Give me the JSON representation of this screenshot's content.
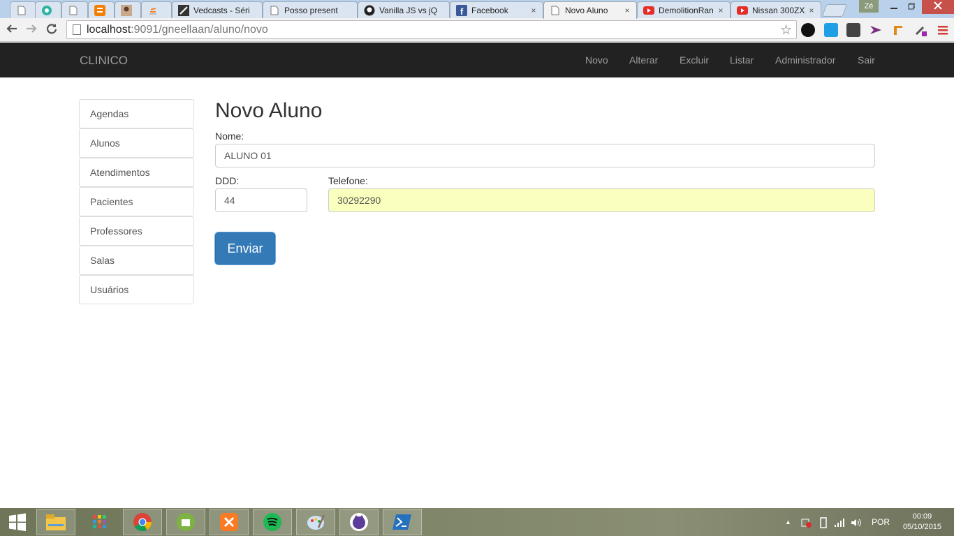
{
  "browser": {
    "tabs": [
      {
        "label": "",
        "icon": "blank-page-icon"
      },
      {
        "label": "",
        "icon": "settings-gear-icon"
      },
      {
        "label": "",
        "icon": "blank-page-icon"
      },
      {
        "label": "",
        "icon": "blogger-icon"
      },
      {
        "label": "",
        "icon": "profile-photo-icon"
      },
      {
        "label": "",
        "icon": "stackoverflow-icon"
      },
      {
        "label": "Vedcasts - Séri",
        "icon": "vedcasts-icon"
      },
      {
        "label": "Posso present",
        "icon": "blank-page-icon"
      },
      {
        "label": "Vanilla JS vs jQ",
        "icon": "github-icon"
      },
      {
        "label": "Facebook",
        "icon": "facebook-icon"
      },
      {
        "label": "Novo Aluno",
        "icon": "blank-page-icon",
        "active": true
      },
      {
        "label": "DemolitionRan",
        "icon": "youtube-icon"
      },
      {
        "label": "Nissan 300ZX",
        "icon": "youtube-icon"
      }
    ],
    "user_badge": "Zé",
    "url_host": "localhost",
    "url_rest": ":9091/gneellaan/aluno/novo",
    "close_glyph": "×"
  },
  "app": {
    "brand": "CLINICO",
    "nav": [
      "Novo",
      "Alterar",
      "Excluir",
      "Listar",
      "Administrador",
      "Sair"
    ],
    "sidebar": [
      "Agendas",
      "Alunos",
      "Atendimentos",
      "Pacientes",
      "Professores",
      "Salas",
      "Usuários"
    ],
    "form": {
      "title": "Novo Aluno",
      "nome_label": "Nome:",
      "nome_value": "ALUNO 01",
      "ddd_label": "DDD:",
      "ddd_value": "44",
      "telefone_label": "Telefone:",
      "telefone_value": "30292290",
      "submit_label": "Enviar"
    },
    "colors": {
      "navbar": "#222222",
      "primary": "#337ab7",
      "autofill": "#faffbd"
    }
  },
  "taskbar": {
    "language": "POR",
    "time": "00:09",
    "date": "05/10/2015"
  }
}
